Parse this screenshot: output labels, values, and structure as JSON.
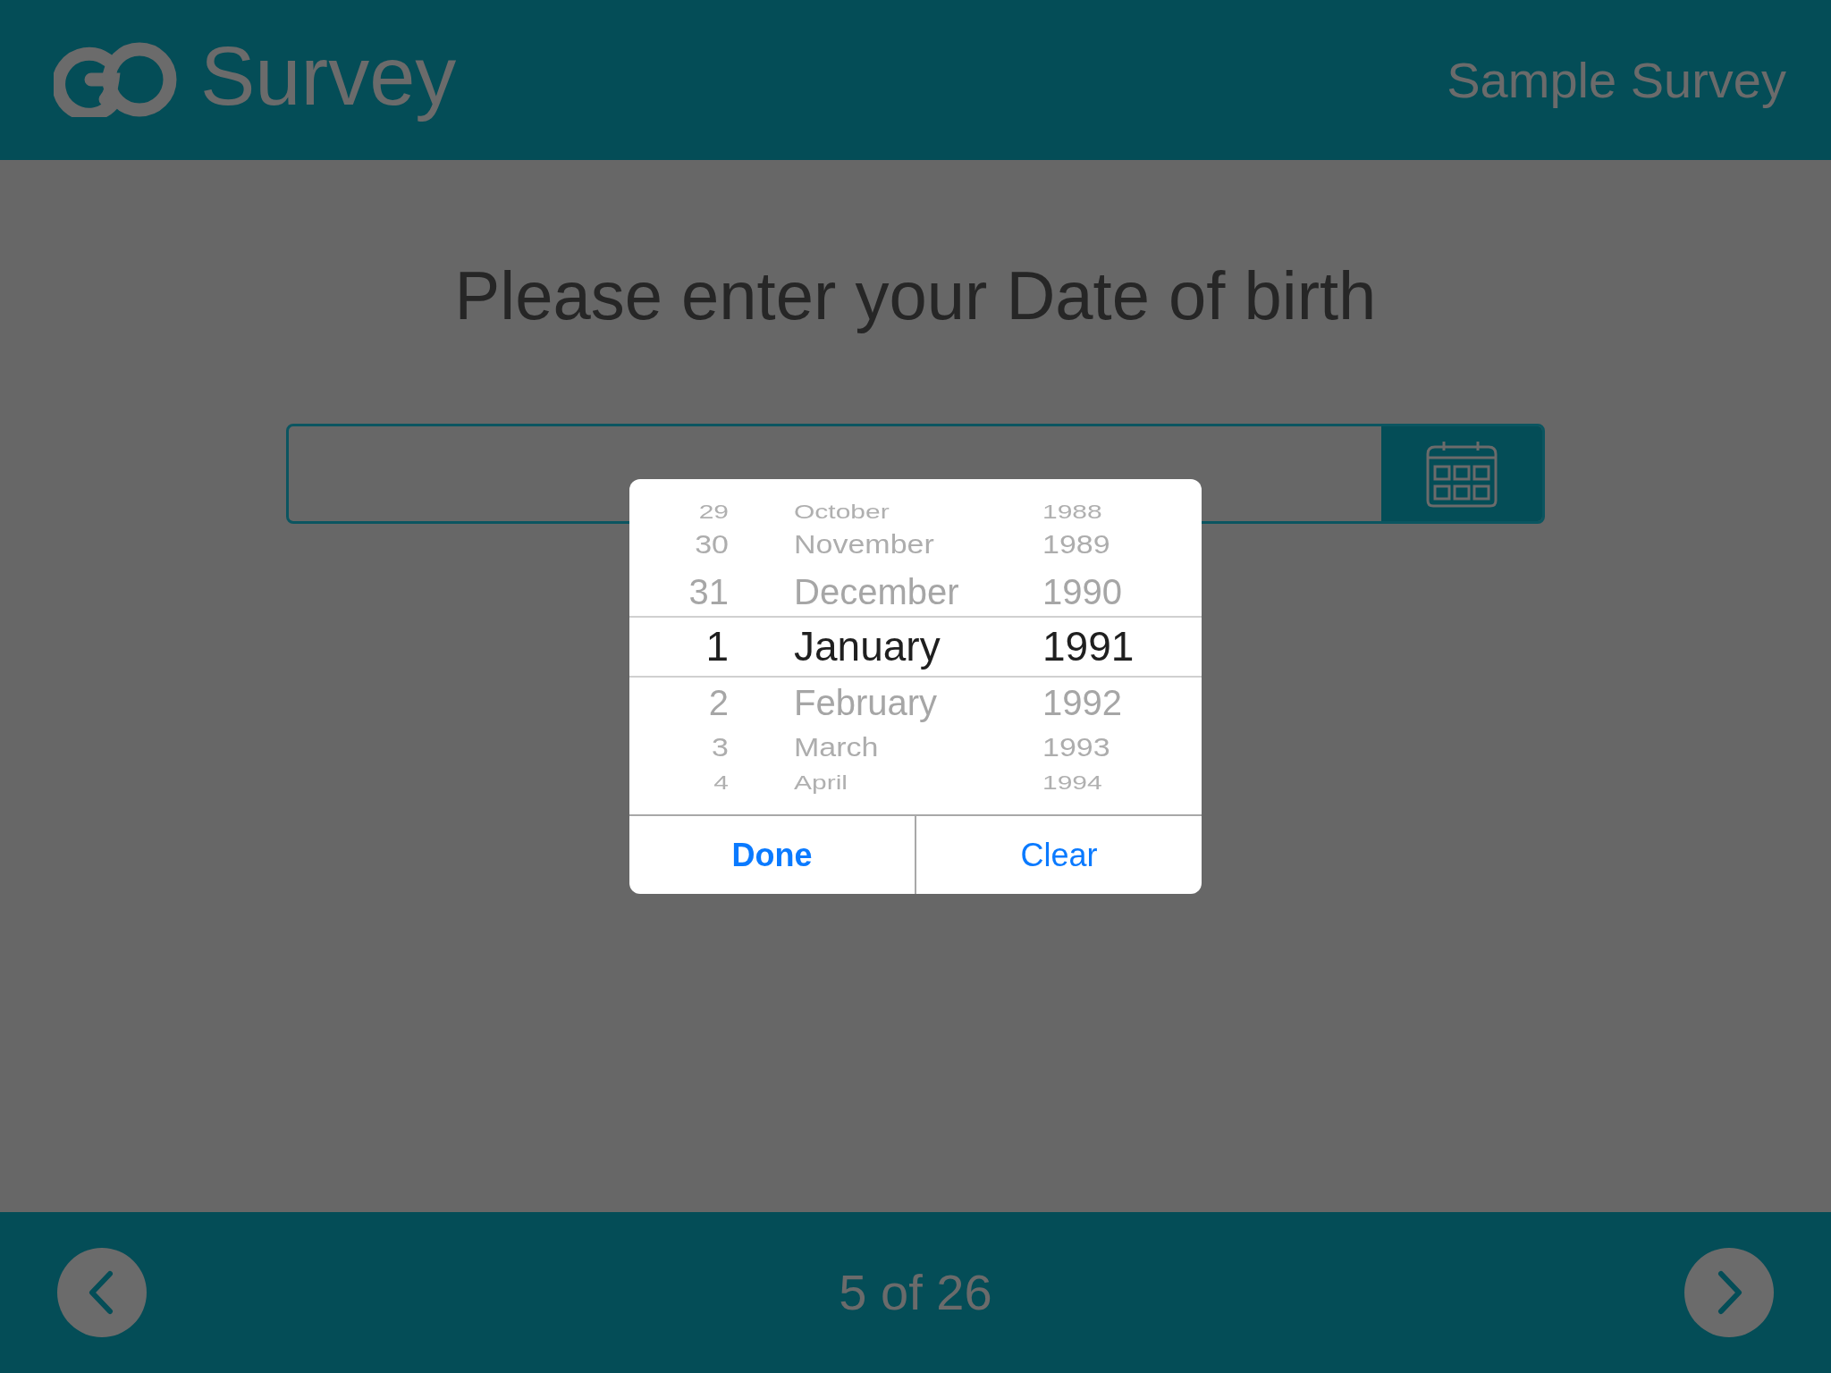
{
  "header": {
    "logo_text": "Survey",
    "survey_name": "Sample Survey"
  },
  "question": "Please enter your Date of birth",
  "picker": {
    "rows": [
      {
        "day": "29",
        "month": "October",
        "year": "1988",
        "selected": false
      },
      {
        "day": "30",
        "month": "November",
        "year": "1989",
        "selected": false
      },
      {
        "day": "31",
        "month": "December",
        "year": "1990",
        "selected": false
      },
      {
        "day": "1",
        "month": "January",
        "year": "1991",
        "selected": true
      },
      {
        "day": "2",
        "month": "February",
        "year": "1992",
        "selected": false
      },
      {
        "day": "3",
        "month": "March",
        "year": "1993",
        "selected": false
      },
      {
        "day": "4",
        "month": "April",
        "year": "1994",
        "selected": false
      }
    ],
    "buttons": [
      {
        "label": "Done",
        "kind": "primary"
      },
      {
        "label": "Clear",
        "kind": "secondary"
      }
    ]
  },
  "footer": {
    "progress": "5 of 26"
  }
}
